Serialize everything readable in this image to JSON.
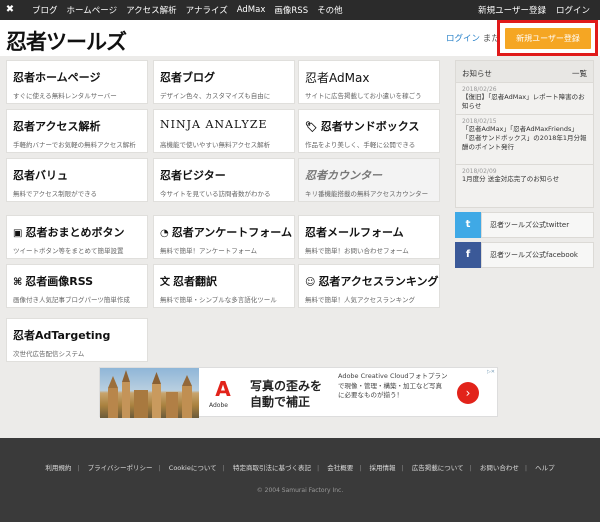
{
  "topbar": {
    "nav": [
      "ブログ",
      "ホームページ",
      "アクセス解析",
      "アナライズ",
      "AdMax",
      "画像RSS",
      "その他"
    ],
    "register": "新規ユーザー登録",
    "login": "ログイン"
  },
  "header": {
    "brand": "忍者ツールズ",
    "login": "ログイン",
    "or": "または",
    "register_button": "新規ユーザー登録"
  },
  "cards": [
    {
      "title": "忍者ホームページ",
      "desc": "すぐに使える無料レンタルサーバー"
    },
    {
      "title": "忍者ブログ",
      "desc": "デザイン色々、カスタマイズも自由に"
    },
    {
      "title": "忍者AdMax",
      "desc": "サイトに広告掲載してお小遣いを稼ごう"
    },
    {
      "title": "忍者アクセス解析",
      "desc": "手軽約バナーでお気軽の無料アクセス解析"
    },
    {
      "title": "NINJA ANALYZE",
      "desc": "高機能で使いやすい無料アクセス解析"
    },
    {
      "title": "忍者サンドボックス",
      "desc": "作品をより美しく、手軽に公開できる"
    },
    {
      "title": "忍者バリュ",
      "desc": "無料でアクセス制限ができる"
    },
    {
      "title": "忍者ビジター",
      "desc": "今サイトを見ている訪問者数がわかる"
    },
    {
      "title": "忍者カウンター",
      "desc": "キリ番機能搭載の無料アクセスカウンター"
    },
    {
      "title": "忍者おまとめボタン",
      "desc": "ツイートボタン等をまとめて簡単設置"
    },
    {
      "title": "忍者アンケートフォーム",
      "desc": "無料で簡単！アンケートフォーム"
    },
    {
      "title": "忍者メールフォーム",
      "desc": "無料で簡単！お問い合わせフォーム"
    },
    {
      "title": "忍者画像RSS",
      "desc": "画像付き人気記事ブログパーツ簡単作成"
    },
    {
      "title": "忍者翻訳",
      "desc": "無料で簡単・シンプルな多言語化ツール"
    },
    {
      "title": "忍者アクセスランキング",
      "desc": "無料で簡単！人気アクセスランキング"
    },
    {
      "title": "忍者AdTargeting",
      "desc": "次世代広告配信システム"
    }
  ],
  "news": {
    "title": "お知らせ",
    "all": "一覧",
    "items": [
      {
        "date": "2018/02/26",
        "text": "【復旧】「忍者AdMax」レポート障害のお知らせ"
      },
      {
        "date": "2018/02/15",
        "text": "「忍者AdMax」「忍者AdMaxFriends」「忍者サンドボックス」の2018年1月分報酬のポイント発行"
      },
      {
        "date": "2018/02/09",
        "text": "1月度分 送金対応完了のお知らせ"
      }
    ]
  },
  "social": {
    "twitter": "忍者ツールズ公式twitter",
    "facebook": "忍者ツールズ公式facebook"
  },
  "ad": {
    "brand": "Adobe",
    "headline_1": "写真の歪みを",
    "headline_2": "自動で補正",
    "sub": "Adobe Creative Cloudフォトプランで現像・管理・構築・加工など写真に必要なものが揃う！"
  },
  "footer": {
    "links": [
      "利用規約",
      "プライバシーポリシー",
      "Cookieについて",
      "特定商取引法に基づく表記",
      "会社概要",
      "採用情報",
      "広告掲載について",
      "お問い合わせ",
      "ヘルプ"
    ],
    "copyright": "© 2004 Samurai Factory Inc."
  }
}
